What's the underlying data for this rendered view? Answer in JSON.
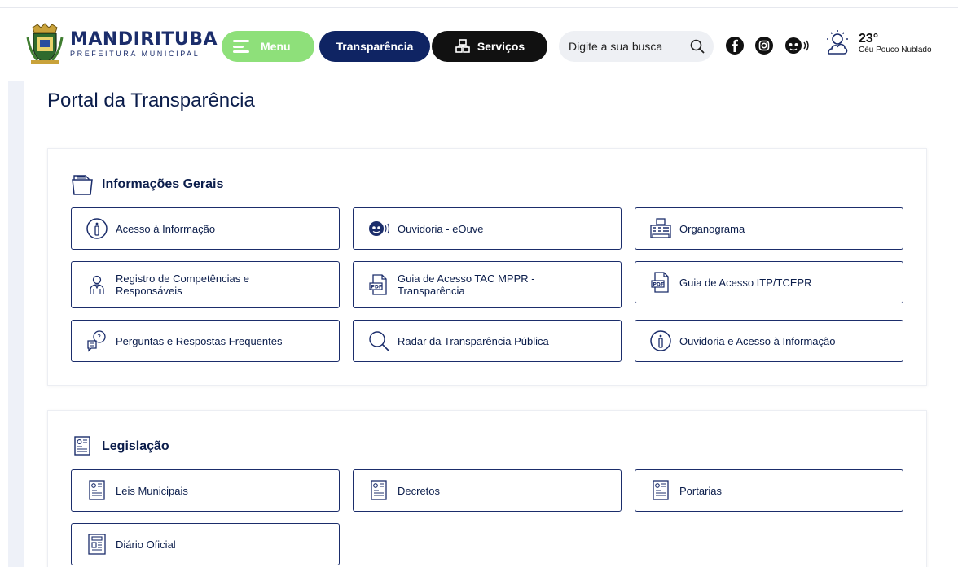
{
  "header": {
    "brand_name": "MANDIRITUBA",
    "brand_sub": "PREFEITURA MUNICIPAL",
    "menu_label": "Menu",
    "transparencia_label": "Transparência",
    "servicos_label": "Serviços",
    "search_placeholder": "Digite a sua busca",
    "weather_temp": "23°",
    "weather_condition": "Céu Pouco Nublado",
    "colors": {
      "menu": "#8ee07a",
      "transparencia": "#0f2463",
      "servicos": "#111111"
    }
  },
  "page": {
    "title": "Portal da Transparência"
  },
  "sections": [
    {
      "title": "Informações Gerais",
      "icon": "folder-documents-icon",
      "items": [
        {
          "label": "Acesso à Informação",
          "icon": "info-icon"
        },
        {
          "label": "Ouvidoria - eOuve",
          "icon": "ouvidoria-icon"
        },
        {
          "label": "Organograma",
          "icon": "building-icon"
        },
        {
          "label": "Registro de Competências e Responsáveis",
          "icon": "person-icon"
        },
        {
          "label": "Guia de Acesso TAC MPPR - Transparência",
          "icon": "pdf-icon"
        },
        {
          "label": "Guia de Acesso ITP/TCEPR",
          "icon": "pdf-icon"
        },
        {
          "label": "Perguntas e Respostas Frequentes",
          "icon": "faq-icon"
        },
        {
          "label": "Radar da Transparência Pública",
          "icon": "search-icon"
        },
        {
          "label": "Ouvidoria e Acesso à Informação",
          "icon": "info-icon"
        }
      ]
    },
    {
      "title": "Legislação",
      "icon": "law-document-icon",
      "items": [
        {
          "label": "Leis Municipais",
          "icon": "law-document-icon"
        },
        {
          "label": "Decretos",
          "icon": "law-document-icon"
        },
        {
          "label": "Portarias",
          "icon": "law-document-icon"
        },
        {
          "label": "Diário Oficial",
          "icon": "newspaper-icon"
        }
      ]
    }
  ]
}
